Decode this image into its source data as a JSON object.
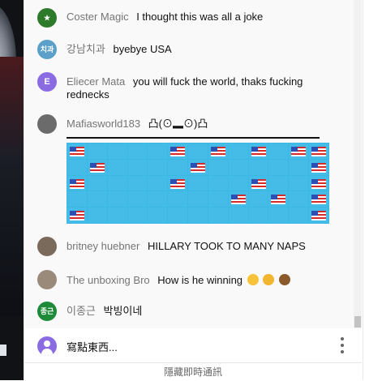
{
  "chat": {
    "messages": [
      {
        "author": "Coster Magic",
        "text": "I thought this was all a joke",
        "avatar_text": "★",
        "avatar_color": "#2d7a2b"
      },
      {
        "author": "강남치과",
        "text": "byebye USA",
        "avatar_text": "치과",
        "avatar_color": "#5aa0c9"
      },
      {
        "author": "Eliecer Mata",
        "text": "you will fuck the world, thaks fucking rednecks",
        "avatar_text": "E",
        "avatar_color": "#8a6be2"
      },
      {
        "author": "Mafiasworld183",
        "text": "凸(⊙▂⊙)凸",
        "avatar_text": "",
        "avatar_color": "#6b6b6b"
      },
      {
        "author": "britney huebner",
        "text": "HILLARY TOOK TO MANY NAPS",
        "avatar_text": "",
        "avatar_color": "#7a6a5c"
      },
      {
        "author": "The unboxing Bro",
        "text": "How is he winning",
        "avatar_text": "",
        "avatar_color": "#9a8a7a"
      },
      {
        "author": "이종근",
        "text": "박빙이네",
        "avatar_text": "종근",
        "avatar_color": "#1d8a3a"
      }
    ],
    "art_image": "Hillary-flag-ascii-art",
    "emojis": [
      "face-with-sweat-emoji",
      "astonished-face-emoji",
      "pile-of-poo-emoji"
    ]
  },
  "input": {
    "placeholder": "寫點東西...",
    "more_icon": "more-vertical-icon"
  },
  "footer": {
    "label": "隱藏即時通訊"
  }
}
